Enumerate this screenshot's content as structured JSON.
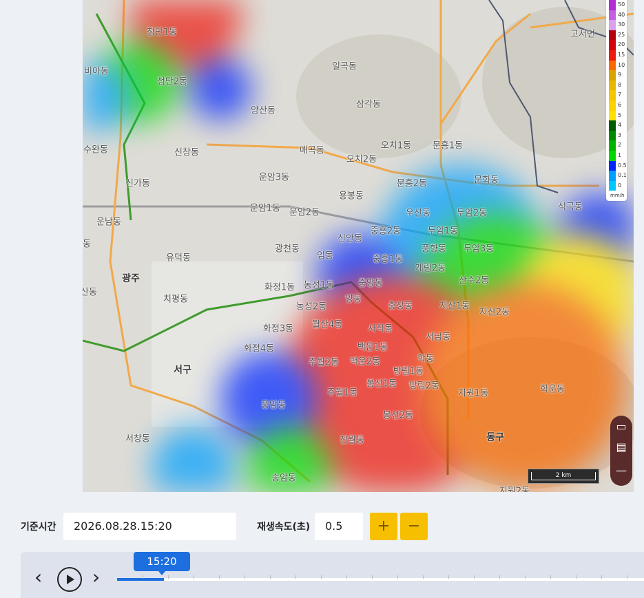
{
  "map": {
    "labels": [
      {
        "text": "첨단1동"
      },
      {
        "text": "첨단2동"
      },
      {
        "text": "비아동"
      },
      {
        "text": "양산동"
      },
      {
        "text": "일곡동"
      },
      {
        "text": "삼각동"
      },
      {
        "text": "매곡동"
      },
      {
        "text": "오치1동"
      },
      {
        "text": "오치2동"
      },
      {
        "text": "문흥1동"
      },
      {
        "text": "문흥2동"
      },
      {
        "text": "문화동"
      },
      {
        "text": "운암3동"
      },
      {
        "text": "운암1동"
      },
      {
        "text": "운암2동"
      },
      {
        "text": "용봉동"
      },
      {
        "text": "우산동"
      },
      {
        "text": "두암2동"
      },
      {
        "text": "두암1동"
      },
      {
        "text": "중흥2동"
      },
      {
        "text": "신안동"
      },
      {
        "text": "풍향동"
      },
      {
        "text": "두암3동"
      },
      {
        "text": "중흥1동"
      },
      {
        "text": "계림2동"
      },
      {
        "text": "석곡동"
      },
      {
        "text": "고서면"
      },
      {
        "text": "수완동"
      },
      {
        "text": "신창동"
      },
      {
        "text": "신가동"
      },
      {
        "text": "운남동"
      },
      {
        "text": "광천동"
      },
      {
        "text": "임동"
      },
      {
        "text": "유덕동"
      },
      {
        "text": "광주"
      },
      {
        "text": "화정1동"
      },
      {
        "text": "농성1동"
      },
      {
        "text": "중앙동"
      },
      {
        "text": "산수2동"
      },
      {
        "text": "치평동"
      },
      {
        "text": "농성2동"
      },
      {
        "text": "양동"
      },
      {
        "text": "충장동"
      },
      {
        "text": "지산1동"
      },
      {
        "text": "지산2동"
      },
      {
        "text": "화정3동"
      },
      {
        "text": "월산4동"
      },
      {
        "text": "사직동"
      },
      {
        "text": "서남동"
      },
      {
        "text": "화정4동"
      },
      {
        "text": "백운1동"
      },
      {
        "text": "학동"
      },
      {
        "text": "서구"
      },
      {
        "text": "주월2동"
      },
      {
        "text": "백운2동"
      },
      {
        "text": "방림1동"
      },
      {
        "text": "봉선1동"
      },
      {
        "text": "방림2동"
      },
      {
        "text": "학운동"
      },
      {
        "text": "주월1동"
      },
      {
        "text": "지원1동"
      },
      {
        "text": "풍암동"
      },
      {
        "text": "봉선2동"
      },
      {
        "text": "서창동"
      },
      {
        "text": "진월동"
      },
      {
        "text": "동구"
      },
      {
        "text": "송암동"
      },
      {
        "text": "동"
      },
      {
        "text": "산동"
      },
      {
        "text": "지원2동"
      }
    ],
    "scale_label": "2 km"
  },
  "legend": {
    "unit": "mm/h",
    "items": [
      {
        "label": "50",
        "color": "#b22bd6"
      },
      {
        "label": "40",
        "color": "#c45fe0"
      },
      {
        "label": "30",
        "color": "#d9a0ee"
      },
      {
        "label": "25",
        "color": "#b5000c"
      },
      {
        "label": "20",
        "color": "#d4000e"
      },
      {
        "label": "15",
        "color": "#ef1c12"
      },
      {
        "label": "10",
        "color": "#fb6a00"
      },
      {
        "label": "9",
        "color": "#d7a400"
      },
      {
        "label": "8",
        "color": "#e8b800"
      },
      {
        "label": "7",
        "color": "#f3c600"
      },
      {
        "label": "6",
        "color": "#fbd200"
      },
      {
        "label": "5",
        "color": "#ffe000"
      },
      {
        "label": "4",
        "color": "#005a00"
      },
      {
        "label": "3",
        "color": "#008a00"
      },
      {
        "label": "2",
        "color": "#00b400"
      },
      {
        "label": "1",
        "color": "#00d900"
      },
      {
        "label": "0.5",
        "color": "#0026ff"
      },
      {
        "label": "0.1",
        "color": "#00a0ff"
      },
      {
        "label": "0",
        "color": "#00c8ff"
      }
    ]
  },
  "controls": {
    "base_time_label": "기준시간",
    "base_time_value": "2026.08.28.15:20",
    "speed_label": "재생속도(초)",
    "speed_value": "0.5",
    "plus": "+",
    "minus": "−"
  },
  "timeline": {
    "current": "15:20",
    "prev": "‹",
    "next": "›"
  }
}
